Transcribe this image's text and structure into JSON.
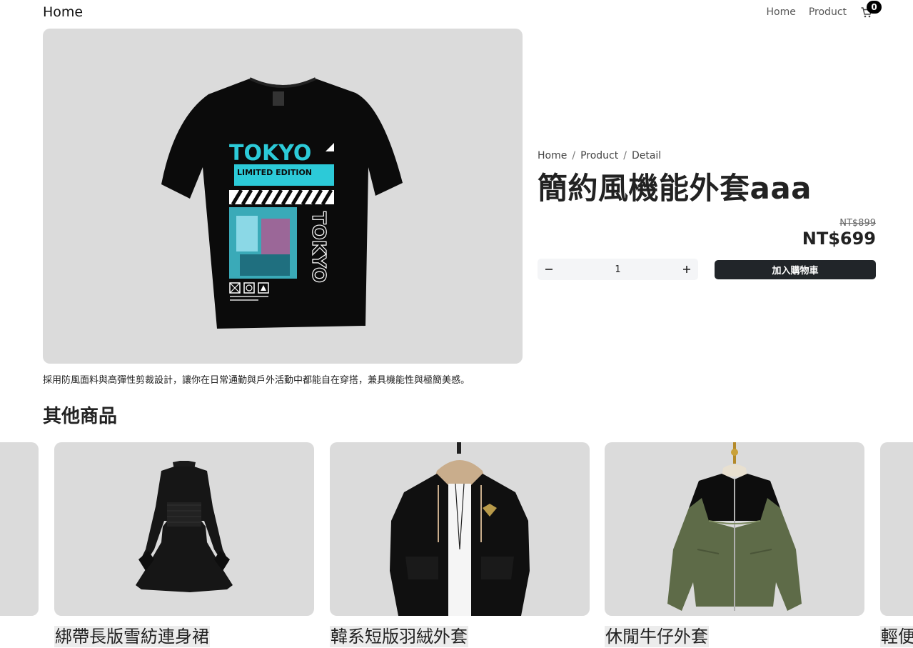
{
  "nav": {
    "brand": "Home",
    "links": [
      "Home",
      "Product"
    ],
    "cart_count": "0"
  },
  "product": {
    "breadcrumb": [
      "Home",
      "Product",
      "Detail"
    ],
    "title": "簡約風機能外套aaa",
    "old_price": "NT$899",
    "price": "NT$699",
    "quantity": "1",
    "add_to_cart_label": "加入購物車",
    "description": "採用防風面料與高彈性剪裁設計，讓你在日常通勤與戶外活動中都能自在穿搭，兼具機能性與極簡美感。",
    "image_print": {
      "headline": "TOKYO",
      "edition": "LIMITED EDITION",
      "vertical": "TOKYO"
    }
  },
  "other": {
    "title": "其他商品",
    "items": [
      {
        "name": "綁帶長版雪紡連身裙"
      },
      {
        "name": "韓系短版羽絨外套"
      },
      {
        "name": "休閒牛仔外套"
      },
      {
        "name": "輕便"
      }
    ]
  },
  "colors": {
    "dark": "#212529",
    "image_bg": "#dbdbdb",
    "print_cyan": "#2ccad8",
    "jacket_green": "#5e6b48"
  },
  "icons": {
    "cart": "cart-icon",
    "minus": "minus-icon",
    "plus": "plus-icon"
  }
}
